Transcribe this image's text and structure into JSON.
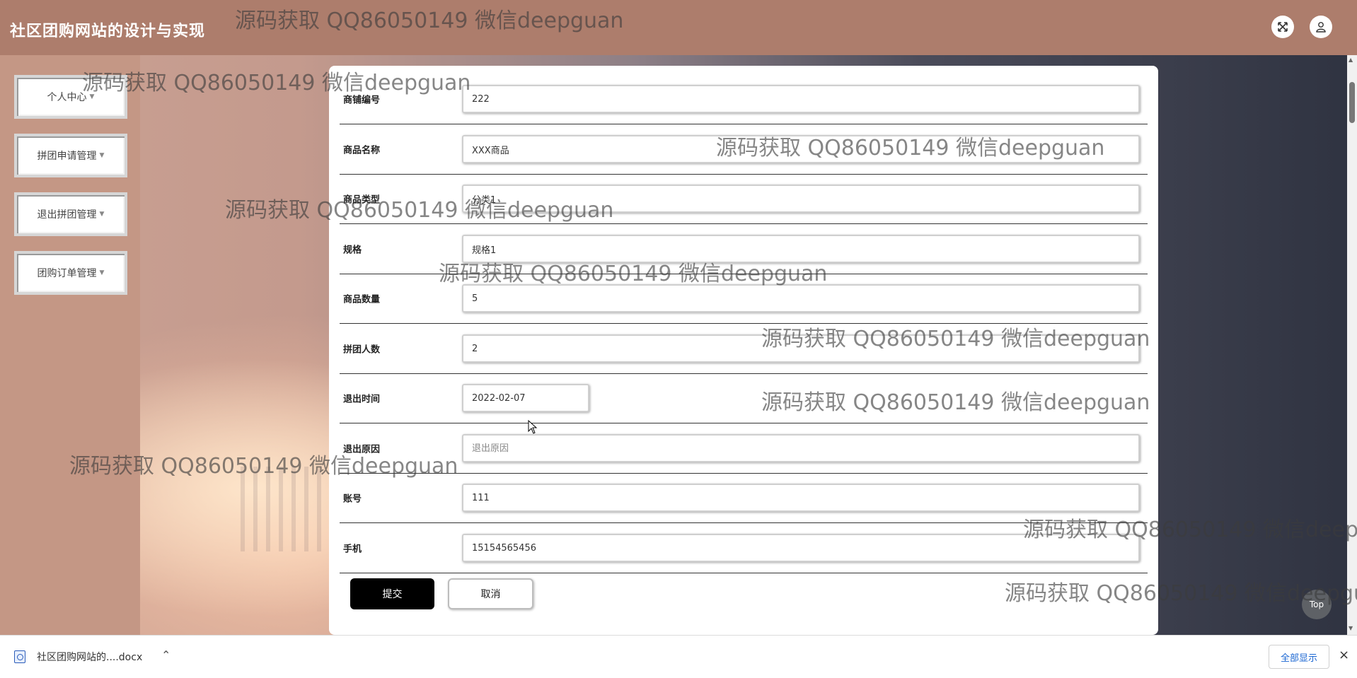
{
  "header": {
    "title": "社区团购网站的设计与实现",
    "fullscreen_icon": "expand-arrows-icon",
    "user_icon": "user-icon"
  },
  "sidebar": {
    "items": [
      {
        "label": "个人中心"
      },
      {
        "label": "拼团申请管理"
      },
      {
        "label": "退出拼团管理"
      },
      {
        "label": "团购订单管理"
      }
    ]
  },
  "form": {
    "fields": [
      {
        "label": "商铺编号",
        "value": "222",
        "placeholder": ""
      },
      {
        "label": "商品名称",
        "value": "XXX商品",
        "placeholder": ""
      },
      {
        "label": "商品类型",
        "value": "分类1",
        "placeholder": ""
      },
      {
        "label": "规格",
        "value": "规格1",
        "placeholder": ""
      },
      {
        "label": "商品数量",
        "value": "5",
        "placeholder": ""
      },
      {
        "label": "拼团人数",
        "value": "2",
        "placeholder": ""
      },
      {
        "label": "退出时间",
        "value": "2022-02-07",
        "placeholder": ""
      },
      {
        "label": "退出原因",
        "value": "",
        "placeholder": "退出原因"
      },
      {
        "label": "账号",
        "value": "111",
        "placeholder": ""
      },
      {
        "label": "手机",
        "value": "15154565456",
        "placeholder": ""
      }
    ],
    "submit_label": "提交",
    "cancel_label": "取消"
  },
  "top_button": {
    "label": "Top"
  },
  "download_bar": {
    "file_name": "社区团购网站的....docx",
    "show_all_label": "全部显示",
    "close_label": "×"
  },
  "watermark": {
    "text": "源码获取 QQ86050149 微信deepguan"
  },
  "colors": {
    "header": "#ad7d6c",
    "sidebar": "#c49785",
    "submit_button": "#000000",
    "link_blue": "#1a66d2"
  }
}
